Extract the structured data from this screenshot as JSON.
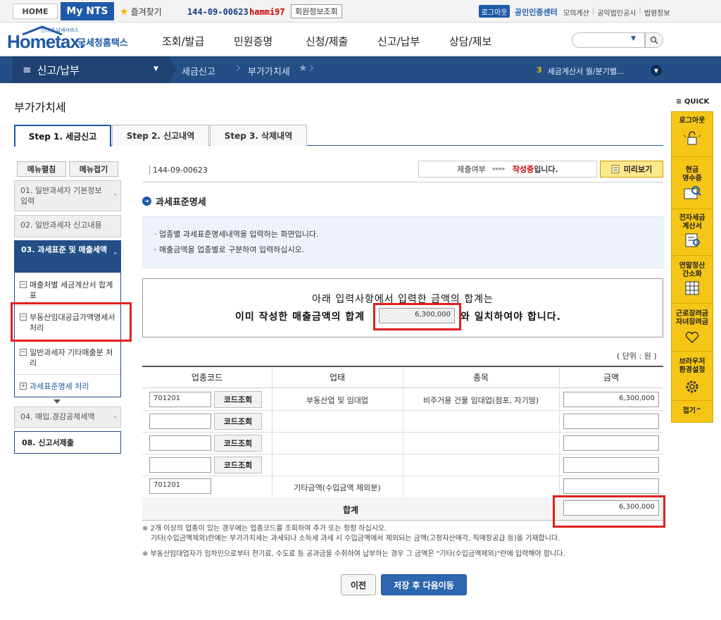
{
  "topbar": {
    "home": "HOME",
    "my_nts": "My NTS",
    "favorites": "즐겨찾기",
    "biz_number": "144-09-00623",
    "user_id": "hammi97",
    "member_info": "회원정보조회",
    "logout": "로그아웃",
    "cert_center": "공인인증센터",
    "links": [
      "모의계산",
      "공익법인공시",
      "법령정보"
    ]
  },
  "header": {
    "logo_small": "인터넷 납세서비스",
    "logo_home": "Hometax.",
    "logo_kr": "국세청홈택스",
    "gnb": [
      "조회/발급",
      "민원증명",
      "신청/제출",
      "신고/납부",
      "상담/제보"
    ]
  },
  "navbar": {
    "menu": "신고/납부",
    "crumb1": "세금신고",
    "crumb2": "부가가치세",
    "right_num": "3",
    "right_text": "세금계산서 월/분기별..."
  },
  "page_title": "부가가치세",
  "tabs": [
    "Step 1. 세금신고",
    "Step 2. 신고내역",
    "Step 3. 삭제내역"
  ],
  "left_menu": {
    "expand": "메뉴펼침",
    "collapse": "메뉴접기",
    "item01": "01. 일반과세자 기본정보 입력",
    "item02": "02. 일반과세자 신고내용",
    "item03": "03. 과세표준 및 매출세액",
    "sub1": "매출처별 세금계산서 합계표",
    "sub2": "부동산임대공급가액명세서 처리",
    "sub3": "일반과세자 기타매출분 처리",
    "sub4": "과세표준명세 처리",
    "item04": "04. 매입,경감공제세액",
    "item08": "08. 신고서제출"
  },
  "content": {
    "biz_no": "144-09-00623",
    "status_label": "제출여부",
    "status_arrows": "▸▸▸▸",
    "status_red": "작성중",
    "status_suffix": "입니다.",
    "preview": "미리보기",
    "section_title": "과세표준명세",
    "info_lines": [
      "업종별 과세표준명세내역을 입력하는 화면입니다.",
      "매출금액을 업종별로 구분하여 입력하십시오."
    ],
    "notice_line1": "아래 입력사항에서 입력한 금액의 합계는",
    "notice_line2_a": "이미 작성한 매출금액의 합계",
    "notice_amount": "6,300,000",
    "notice_line2_b": "와 일치하여야 합니다.",
    "unit": "( 단위 : 원 )"
  },
  "table": {
    "headers": [
      "업종코드",
      "업태",
      "종목",
      "금액"
    ],
    "code_btn": "코드조회",
    "rows": [
      {
        "code": "701201",
        "business": "부동산업 및 임대업",
        "item": "비주거용 건물 임대업(점포, 자기땅)",
        "amount": "6,300,000"
      },
      {
        "code": "",
        "business": "",
        "item": "",
        "amount": ""
      },
      {
        "code": "",
        "business": "",
        "item": "",
        "amount": ""
      },
      {
        "code": "",
        "business": "",
        "item": "",
        "amount": ""
      }
    ],
    "other_code": "701201",
    "other_label": "기타금액(수입금액 제외분)",
    "other_amount": "",
    "total_label": "합계",
    "total_amount": "6,300,000"
  },
  "footnotes": {
    "note1": "※ 2개 이상의 업종이 있는 경우에는 업종코드를 조회하여 추가 또는 정정 하십시오.",
    "note2": "기타(수입금액제외)란에는 부가가치세는 과세되나 소득세 과세 시 수입금액에서 제외되는 금액(고정자산매각, 직매장공급 등)을 기재합니다.",
    "note3": "※ 부동산임대업자가 임차인으로부터 전기료, 수도료 등 공과금을 수취하여 납부하는 경우 그 금액은 \"기타(수입금액제외)\"란에 입력해야 합니다."
  },
  "buttons": {
    "prev": "이전",
    "save_next": "저장 후 다음이동"
  },
  "quick": {
    "title": "QUICK",
    "items": [
      "로그아웃",
      "현금영수증",
      "전자세금계산서",
      "연말정산간소화",
      "근로장려금자녀장려금",
      "브라우저환경설정"
    ],
    "item_lines": [
      [
        "로그아웃"
      ],
      [
        "현금",
        "영수증"
      ],
      [
        "전자세금",
        "계산서"
      ],
      [
        "연말정산",
        "간소화"
      ],
      [
        "근로장려금",
        "자녀장려금"
      ],
      [
        "브라우저",
        "환경설정"
      ]
    ],
    "fold": "접기^"
  },
  "colors": {
    "brand_blue": "#1e5aa8",
    "nav_blue": "#244f86",
    "quick_yellow": "#f6c616",
    "highlight_red": "#e02020"
  }
}
